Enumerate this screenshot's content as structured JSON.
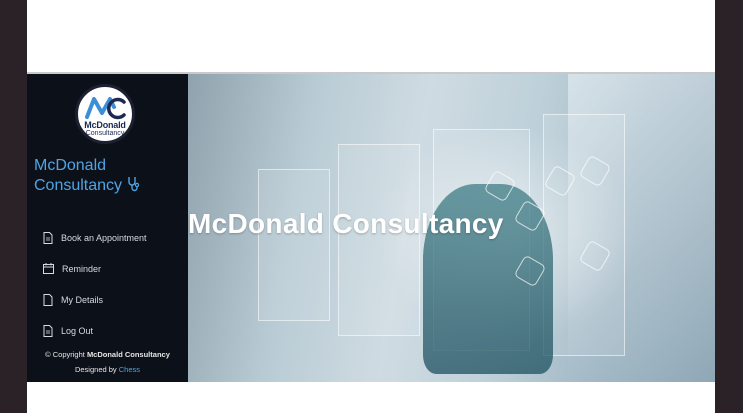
{
  "brand": {
    "logo_text": "McDonald",
    "logo_sub": "Consultancy",
    "name": "McDonald Consultancy"
  },
  "menu": [
    {
      "label": "Book an Appointment",
      "icon": "document-icon"
    },
    {
      "label": "Reminder",
      "icon": "calendar-icon"
    },
    {
      "label": "My Details",
      "icon": "document-icon"
    },
    {
      "label": "Log Out",
      "icon": "document-icon"
    }
  ],
  "footer": {
    "copyright_prefix": "© Copyright",
    "copyright_name": "McDonald Consultancy",
    "designed_prefix": "Designed by",
    "designer": "Chess"
  },
  "hero": {
    "title": "McDonald Consultancy"
  },
  "colors": {
    "sidebar_bg": "#0c1119",
    "accent": "#4fa4e4",
    "menu_text": "#d6dae0"
  }
}
